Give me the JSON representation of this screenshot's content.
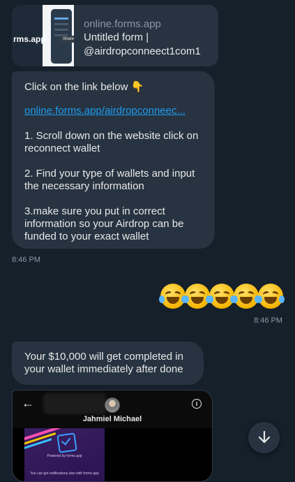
{
  "link_preview": {
    "thumbnail_text": "rms.app",
    "thumbnail_share": "Share",
    "domain": "online.forms.app",
    "title_line1": "Untitled form |",
    "title_line2": "@airdropconneect1com1"
  },
  "message1": {
    "intro": "Click on the link below 👇",
    "link": "online.forms.app/airdropconneec...",
    "step1": "1. Scroll down on the website click on reconnect wallet",
    "step2": "2. Find your type of wallets and input the necessary information",
    "step3": "3.make sure you put in correct information so your Airdrop can be funded to your exact wallet",
    "timestamp": "8:46 PM"
  },
  "sent_message": {
    "emoji_name": "rolling-on-floor-laughing",
    "emoji_count": 5,
    "timestamp": "8:46 PM"
  },
  "message2": {
    "text": "Your $10,000 will get completed in your wallet immediately after done"
  },
  "media_card": {
    "profile_name": "Jahmiel Michael",
    "preview_powered": "Powered by forms.app",
    "preview_notify": "You can get notifications also with forms.app"
  },
  "icons": {
    "back": "arrow-left-icon",
    "info": "info-icon",
    "scroll_down": "arrow-down-icon"
  },
  "colors": {
    "background": "#15202b",
    "bubble": "#273340",
    "link": "#1d9bf0",
    "muted": "#8b98a5"
  }
}
